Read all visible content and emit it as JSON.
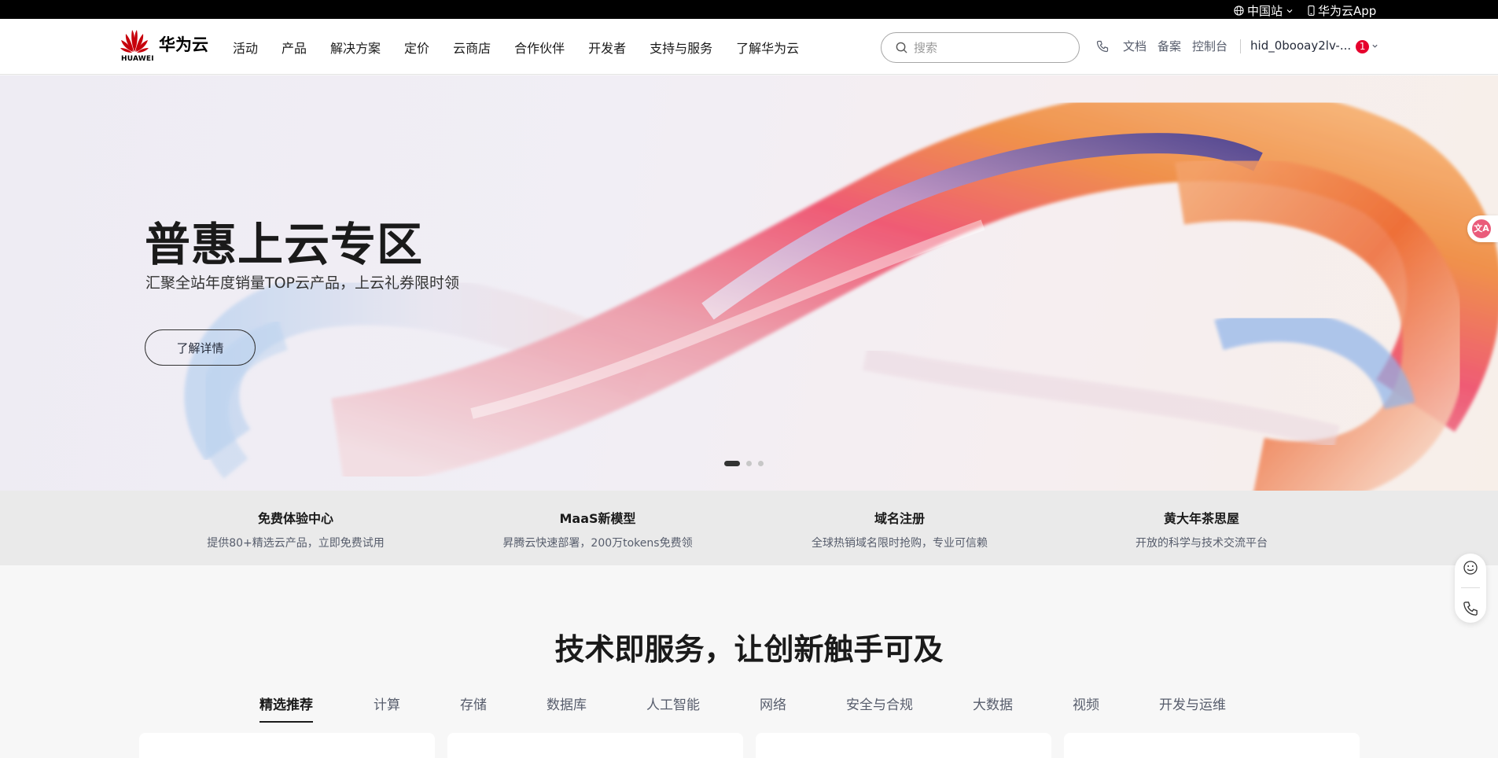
{
  "topbar": {
    "region": "中国站",
    "app": "华为云App"
  },
  "header": {
    "brand": "华为云",
    "logo_text": "HUAWEI",
    "nav": [
      "活动",
      "产品",
      "解决方案",
      "定价",
      "云商店",
      "合作伙伴",
      "开发者",
      "支持与服务",
      "了解华为云"
    ],
    "search_placeholder": "搜索",
    "links": [
      "文档",
      "备案",
      "控制台"
    ],
    "user": "hid_0booay2lv-...",
    "badge": "1"
  },
  "hero": {
    "title": "普惠上云专区",
    "subtitle": "汇聚全站年度销量TOP云产品，上云礼券限时领",
    "button": "了解详情",
    "slides": 3,
    "active_slide": 0
  },
  "features": [
    {
      "title": "免费体验中心",
      "desc": "提供80+精选云产品，立即免费试用"
    },
    {
      "title": "MaaS新模型",
      "desc": "昇腾云快速部署，200万tokens免费领"
    },
    {
      "title": "域名注册",
      "desc": "全球热销域名限时抢购，专业可信赖"
    },
    {
      "title": "黄大年茶思屋",
      "desc": "开放的科学与技术交流平台"
    }
  ],
  "section": {
    "title": "技术即服务，让创新触手可及",
    "tabs": [
      "精选推荐",
      "计算",
      "存储",
      "数据库",
      "人工智能",
      "网络",
      "安全与合规",
      "大数据",
      "视频",
      "开发与运维"
    ],
    "active_tab": 0
  },
  "widgets": {
    "translate_label": "文A"
  },
  "colors": {
    "brand_red": "#c7000b",
    "badge_red": "#e6002d",
    "text_dark": "#1a1a1a"
  }
}
